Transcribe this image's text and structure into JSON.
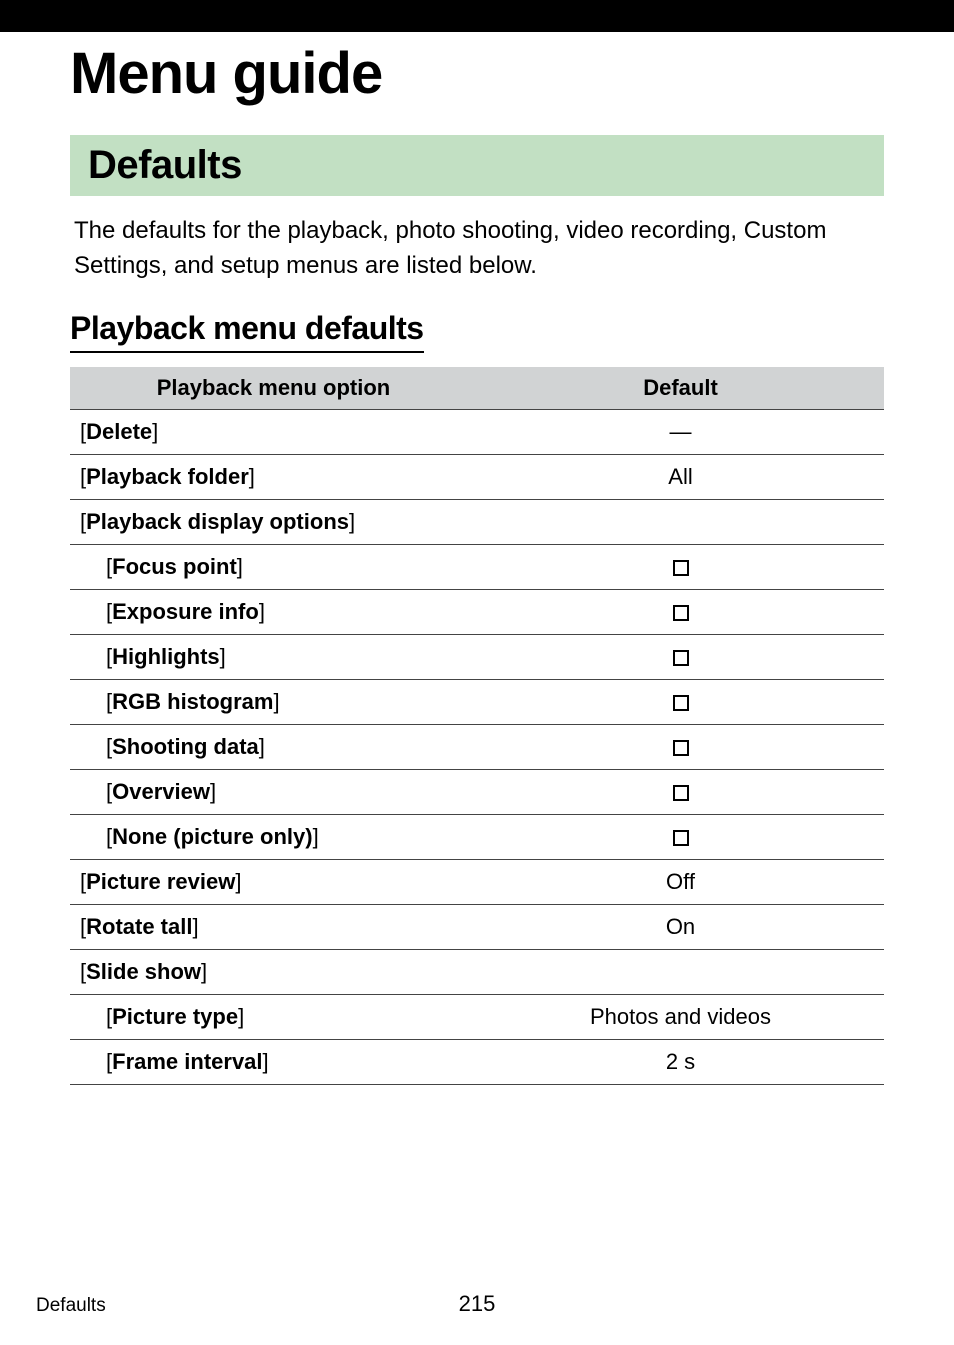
{
  "chapter_title": "Menu guide",
  "section_header": "Defaults",
  "intro_text": "The defaults for the playback, photo shooting, video recording, Custom Settings, and setup menus are listed below.",
  "subsection_title": "Playback menu defaults",
  "table": {
    "headers": {
      "option": "Playback menu option",
      "default": "Default"
    },
    "rows": {
      "delete": {
        "label": "Delete",
        "value": "—"
      },
      "playback_folder": {
        "label": "Playback folder",
        "value": "All"
      },
      "playback_display_options": {
        "label": "Playback display options"
      },
      "focus_point": {
        "label": "Focus point"
      },
      "exposure_info": {
        "label": "Exposure info"
      },
      "highlights": {
        "label": "Highlights"
      },
      "rgb_histogram": {
        "label": "RGB histogram"
      },
      "shooting_data": {
        "label": "Shooting data"
      },
      "overview": {
        "label": "Overview"
      },
      "none_picture_only": {
        "label": "None (picture only)"
      },
      "picture_review": {
        "label": "Picture review",
        "value": "Off"
      },
      "rotate_tall": {
        "label": "Rotate tall",
        "value": "On"
      },
      "slide_show": {
        "label": "Slide show"
      },
      "picture_type": {
        "label": "Picture type",
        "value": "Photos and videos"
      },
      "frame_interval": {
        "label": "Frame interval",
        "value": "2 s"
      }
    }
  },
  "footer_label": "Defaults",
  "page_number": "215"
}
